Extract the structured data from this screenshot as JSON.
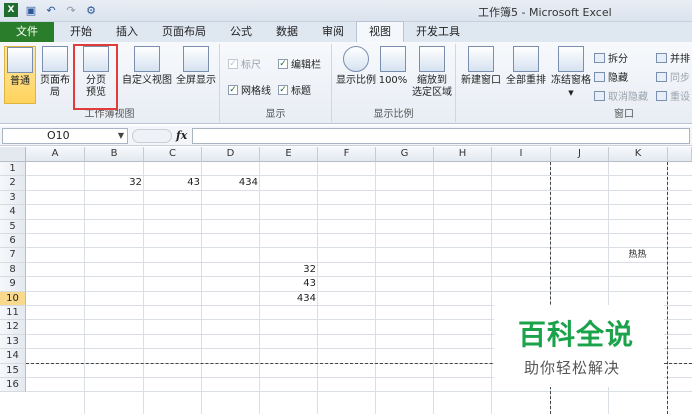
{
  "window": {
    "title": "工作簿5 - Microsoft Excel"
  },
  "quick_access": [
    "save-icon",
    "undo-icon",
    "redo-icon",
    "customize-icon"
  ],
  "tabs": [
    {
      "label": "文件"
    },
    {
      "label": "开始"
    },
    {
      "label": "插入"
    },
    {
      "label": "页面布局"
    },
    {
      "label": "公式"
    },
    {
      "label": "数据"
    },
    {
      "label": "审阅"
    },
    {
      "label": "视图"
    },
    {
      "label": "开发工具"
    }
  ],
  "active_tab": "视图",
  "ribbon": {
    "workbook_views": {
      "label": "工作簿视图",
      "normal": "普通",
      "page_layout": "页面布局",
      "page_break_1": "分页",
      "page_break_2": "预览",
      "custom_views": "自定义视图",
      "full_screen": "全屏显示"
    },
    "show": {
      "label": "显示",
      "ruler": "标尺",
      "gridlines": "网格线",
      "formula_bar": "编辑栏",
      "headings": "标题"
    },
    "zoom": {
      "label": "显示比例",
      "zoom": "显示比例",
      "zoom_100": "100%",
      "zoom_sel_1": "缩放到",
      "zoom_sel_2": "选定区域"
    },
    "window": {
      "label": "窗口",
      "new_window": "新建窗口",
      "arrange_all": "全部重排",
      "freeze_panes": "冻结窗格",
      "split": "拆分",
      "hide": "隐藏",
      "unhide": "取消隐藏",
      "side_by_side": "并排",
      "sync_scroll": "同步",
      "reset_pos": "重设"
    }
  },
  "formula_bar": {
    "name_box": "O10",
    "fx": "fx",
    "value": ""
  },
  "columns": [
    "A",
    "B",
    "C",
    "D",
    "E",
    "F",
    "G",
    "H",
    "I",
    "J",
    "K"
  ],
  "rows": [
    "1",
    "2",
    "3",
    "4",
    "5",
    "6",
    "7",
    "8",
    "9",
    "10",
    "11",
    "12",
    "13",
    "14",
    "15",
    "16"
  ],
  "cells": {
    "B2": "32",
    "C2": "43",
    "D2": "434",
    "K7": "热热",
    "E8": "32",
    "E9": "43",
    "E10": "434"
  },
  "watermark": {
    "title": "百科全说",
    "subtitle": "助你轻松解决"
  }
}
